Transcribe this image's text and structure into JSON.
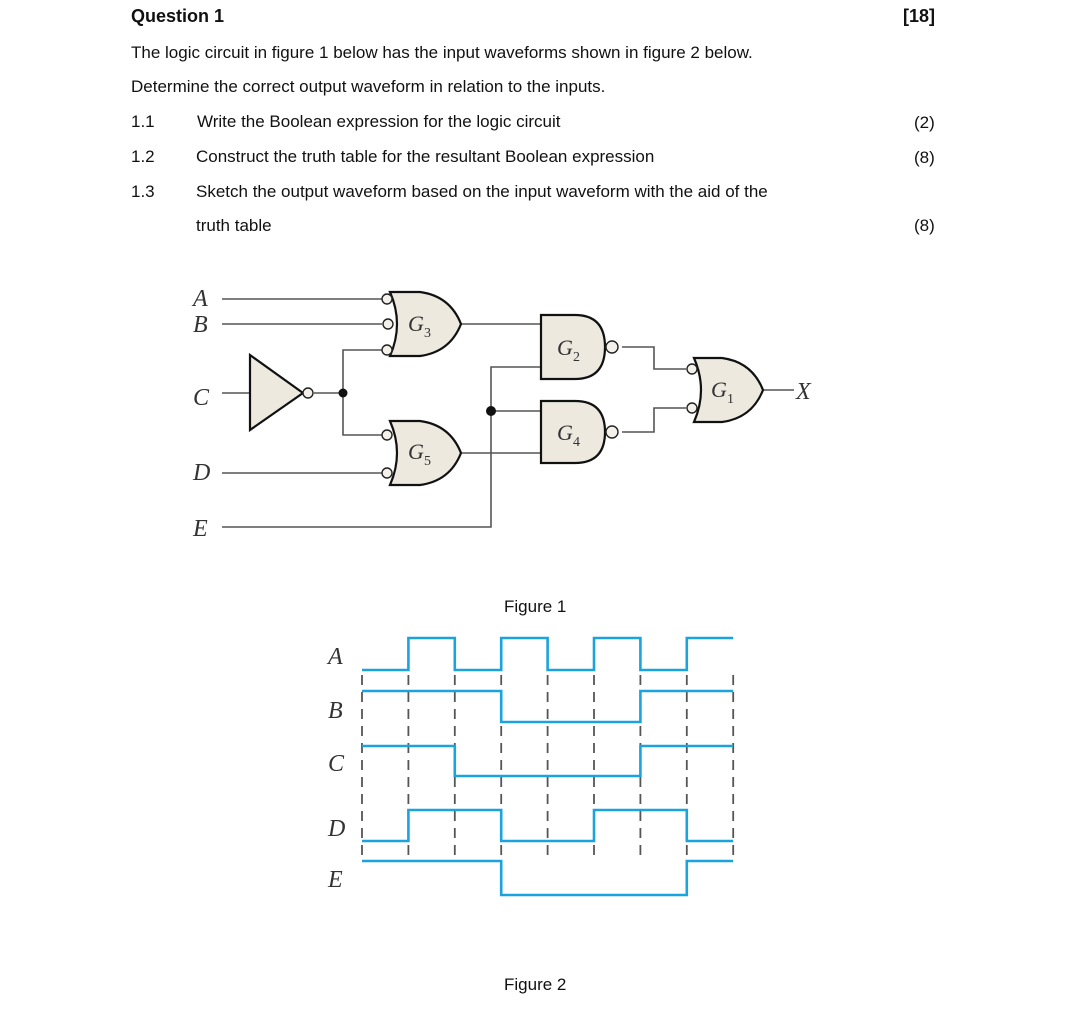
{
  "question": {
    "title": "Question 1",
    "marks": "[18]",
    "intro_line1": "The logic circuit in figure 1 below has the input waveforms shown in figure 2 below.",
    "intro_line2": "Determine the correct output waveform in relation to the inputs.",
    "items": [
      {
        "num": "1.1",
        "text": " Write the Boolean expression for the logic circuit",
        "marks": "(2)"
      },
      {
        "num": "1.2",
        "text": "Construct the truth table for the resultant Boolean expression",
        "marks": "(8)"
      },
      {
        "num": "1.3",
        "text": "Sketch the output waveform based on the input waveform with the aid of the",
        "text2": "truth table",
        "marks": "(8)"
      }
    ]
  },
  "figure1": {
    "caption": "Figure 1",
    "inputs": [
      "A",
      "B",
      "C",
      "D",
      "E"
    ],
    "output": "X",
    "gates": {
      "g3": {
        "letter": "G",
        "sub": "3"
      },
      "g5": {
        "letter": "G",
        "sub": "5"
      },
      "g2": {
        "letter": "G",
        "sub": "2"
      },
      "g4": {
        "letter": "G",
        "sub": "4"
      },
      "g1": {
        "letter": "G",
        "sub": "1"
      }
    }
  },
  "figure2": {
    "caption": "Figure 2",
    "color": "#1aa3dc",
    "signals": [
      {
        "name": "A",
        "levels": [
          0,
          1,
          0,
          1,
          0,
          1,
          0,
          1
        ]
      },
      {
        "name": "B",
        "levels": [
          1,
          1,
          1,
          0,
          0,
          0,
          1,
          1
        ]
      },
      {
        "name": "C",
        "levels": [
          1,
          1,
          0,
          0,
          0,
          0,
          1,
          1
        ]
      },
      {
        "name": "D",
        "levels": [
          0,
          1,
          1,
          0,
          0,
          1,
          1,
          0
        ]
      },
      {
        "name": "E",
        "levels": [
          1,
          1,
          1,
          0,
          0,
          0,
          0,
          1
        ]
      }
    ]
  }
}
